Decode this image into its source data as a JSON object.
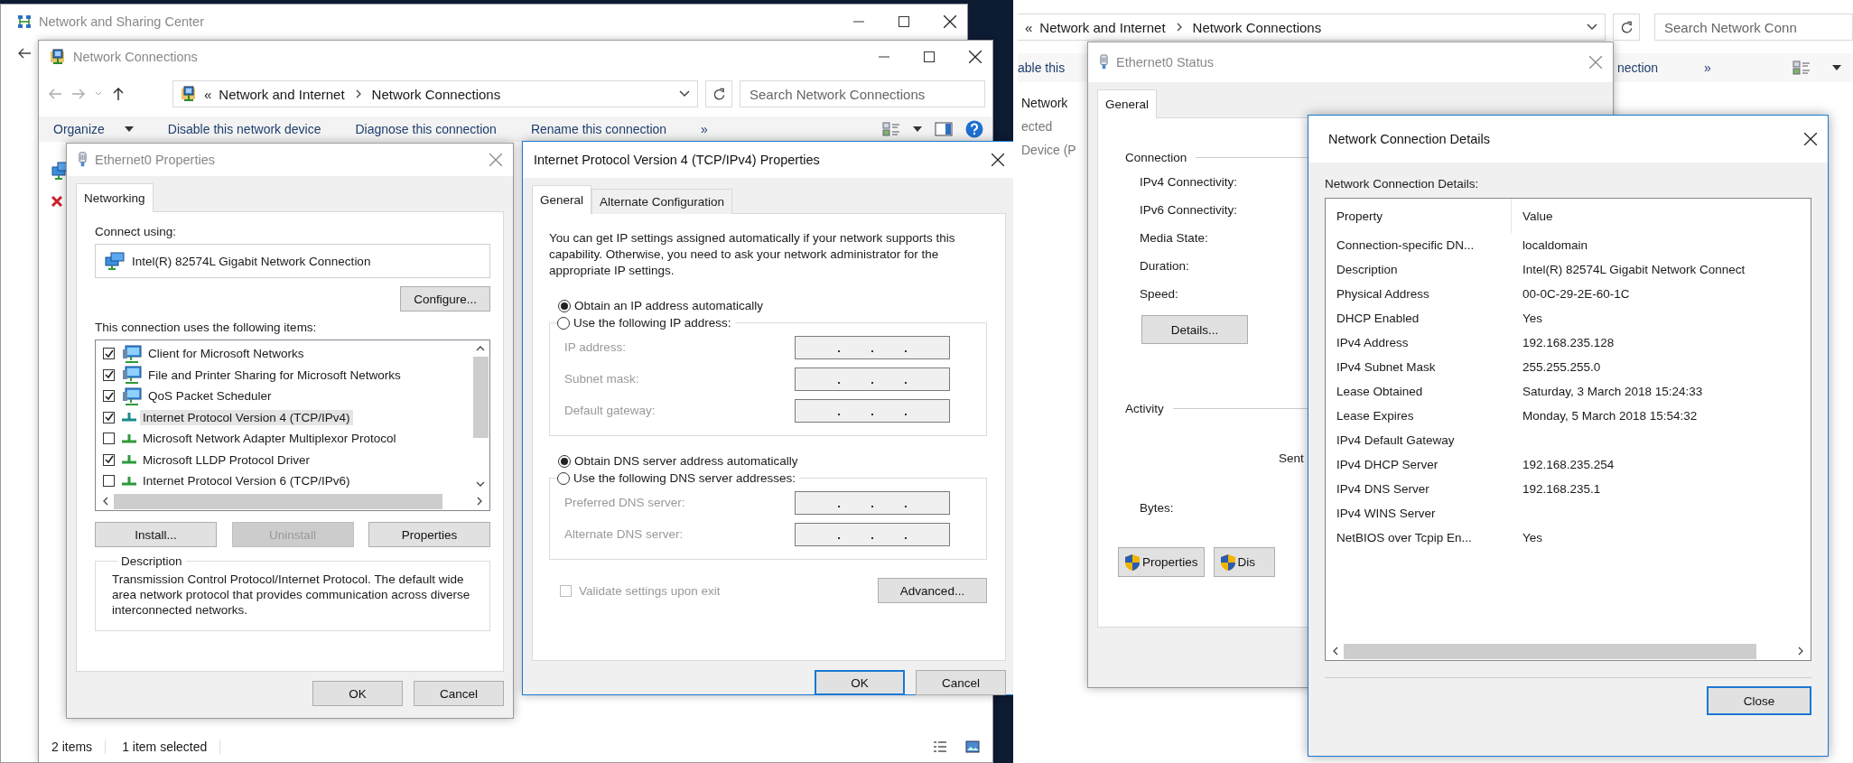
{
  "left_capture": {
    "sharing_center": {
      "title": "Network and Sharing Center",
      "active": false
    },
    "explorer": {
      "title": "Network Connections",
      "active": false,
      "address": {
        "prefix": "«",
        "path": [
          "Network and Internet",
          "Network Connections"
        ]
      },
      "search": {
        "placeholder": "Search Network Connections"
      },
      "toolbar": [
        {
          "label": "Organize",
          "menu": true
        },
        {
          "label": "Disable this network device",
          "menu": false
        },
        {
          "label": "Diagnose this connection",
          "menu": false
        },
        {
          "label": "Rename this connection",
          "menu": false
        },
        {
          "label": "»",
          "menu": false
        }
      ],
      "status_bar": [
        "2 items",
        "1 item selected"
      ]
    },
    "ethernet_properties": {
      "title": "Ethernet0 Properties",
      "active": false,
      "tabs": [
        {
          "label": "Networking",
          "selected": true
        }
      ],
      "connect_using_label": "Connect using:",
      "adapter": "Intel(R) 82574L Gigabit Network Connection",
      "configure_button": "Configure...",
      "items_label": "This connection uses the following items:",
      "items": [
        {
          "label": "Client for Microsoft Networks",
          "kind": "client",
          "checked": true,
          "selected": false
        },
        {
          "label": "File and Printer Sharing for Microsoft Networks",
          "kind": "client",
          "checked": true,
          "selected": false
        },
        {
          "label": "QoS Packet Scheduler",
          "kind": "client",
          "checked": true,
          "selected": false
        },
        {
          "label": "Internet Protocol Version 4 (TCP/IPv4)",
          "kind": "protocol",
          "checked": true,
          "selected": true
        },
        {
          "label": "Microsoft Network Adapter Multiplexor Protocol",
          "kind": "protocol",
          "checked": false,
          "selected": false
        },
        {
          "label": "Microsoft LLDP Protocol Driver",
          "kind": "protocol",
          "checked": true,
          "selected": false
        },
        {
          "label": "Internet Protocol Version 6 (TCP/IPv6)",
          "kind": "protocol",
          "checked": false,
          "selected": false
        }
      ],
      "buttons": [
        {
          "label": "Install...",
          "disabled": false
        },
        {
          "label": "Uninstall",
          "disabled": true
        },
        {
          "label": "Properties",
          "disabled": false
        }
      ],
      "description": {
        "legend": "Description",
        "text": "Transmission Control Protocol/Internet Protocol. The default wide area network protocol that provides communication across diverse interconnected networks."
      },
      "footer_buttons": [
        {
          "label": "OK",
          "default": false
        },
        {
          "label": "Cancel",
          "default": false
        }
      ]
    },
    "ipv4_properties": {
      "title": "Internet Protocol Version 4 (TCP/IPv4) Properties",
      "active": true,
      "tabs": [
        {
          "label": "General",
          "selected": true
        },
        {
          "label": "Alternate Configuration",
          "selected": false
        }
      ],
      "intro": "You can get IP settings assigned automatically if your network supports this capability. Otherwise, you need to ask your network administrator for the appropriate IP settings.",
      "ip_section": {
        "auto_option": {
          "label": "Obtain an IP address automatically",
          "selected": true
        },
        "manual_option": {
          "label": "Use the following IP address:",
          "selected": false
        },
        "disabled": true,
        "fields": [
          {
            "label": "IP address:"
          },
          {
            "label": "Subnet mask:"
          },
          {
            "label": "Default gateway:"
          }
        ]
      },
      "dns_section": {
        "auto_option": {
          "label": "Obtain DNS server address automatically",
          "selected": true
        },
        "manual_option": {
          "label": "Use the following DNS server addresses:",
          "selected": false
        },
        "disabled": true,
        "fields": [
          {
            "label": "Preferred DNS server:"
          },
          {
            "label": "Alternate DNS server:"
          }
        ]
      },
      "validate": {
        "label": "Validate settings upon exit",
        "checked": false,
        "disabled": true
      },
      "advanced_button": "Advanced...",
      "footer_buttons": [
        {
          "label": "OK",
          "default": true
        },
        {
          "label": "Cancel",
          "default": false
        }
      ]
    }
  },
  "right_capture": {
    "explorer": {
      "address": {
        "prefix": "«",
        "path": [
          "Network and Internet",
          "Network Connections"
        ]
      },
      "search": {
        "placeholder": "Search Network Conn"
      },
      "toolbar_fragments": [
        "able this",
        "nection",
        "»"
      ],
      "list_fragments": [
        "Network",
        "ected",
        "Device (P"
      ]
    },
    "status_window": {
      "title": "Ethernet0 Status",
      "active": false,
      "tabs": [
        {
          "label": "General",
          "selected": true
        }
      ],
      "connection_legend": "Connection",
      "connection_labels": [
        "IPv4 Connectivity:",
        "IPv6 Connectivity:",
        "Media State:",
        "Duration:",
        "Speed:"
      ],
      "details_button": "Details...",
      "activity_legend": "Activity",
      "sent_label": "Sent",
      "bytes_label": "Bytes:",
      "buttons": [
        "Properties",
        "Dis"
      ]
    },
    "details_window": {
      "title": "Network Connection Details",
      "active": true,
      "label": "Network Connection Details:",
      "columns": [
        "Property",
        "Value"
      ],
      "rows": [
        [
          "Connection-specific DN...",
          "localdomain"
        ],
        [
          "Description",
          "Intel(R) 82574L Gigabit Network Connect"
        ],
        [
          "Physical Address",
          "00-0C-29-2E-60-1C"
        ],
        [
          "DHCP Enabled",
          "Yes"
        ],
        [
          "IPv4 Address",
          "192.168.235.128"
        ],
        [
          "IPv4 Subnet Mask",
          "255.255.255.0"
        ],
        [
          "Lease Obtained",
          "Saturday, 3 March 2018 15:24:33"
        ],
        [
          "Lease Expires",
          "Monday, 5 March 2018 15:54:32"
        ],
        [
          "IPv4 Default Gateway",
          ""
        ],
        [
          "IPv4 DHCP Server",
          "192.168.235.254"
        ],
        [
          "IPv4 DNS Server",
          "192.168.235.1"
        ],
        [
          "IPv4 WINS Server",
          ""
        ],
        [
          "NetBIOS over Tcpip En...",
          "Yes"
        ]
      ],
      "close_button": "Close"
    }
  }
}
